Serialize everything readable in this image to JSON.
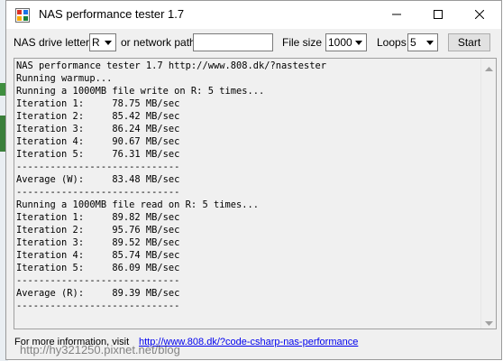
{
  "window": {
    "title": "NAS performance tester 1.7"
  },
  "toolbar": {
    "drive_label": "NAS drive letter",
    "drive_value": "R",
    "network_label": "or network path",
    "network_value": "",
    "filesize_label": "File size",
    "filesize_value": "1000",
    "loops_label": "Loops",
    "loops_value": "5",
    "start_label": "Start"
  },
  "output": {
    "text": "NAS performance tester 1.7 http://www.808.dk/?nastester\nRunning warmup...\nRunning a 1000MB file write on R: 5 times...\nIteration 1:     78.75 MB/sec\nIteration 2:     85.42 MB/sec\nIteration 3:     86.24 MB/sec\nIteration 4:     90.67 MB/sec\nIteration 5:     76.31 MB/sec\n-----------------------------\nAverage (W):     83.48 MB/sec\n-----------------------------\nRunning a 1000MB file read on R: 5 times...\nIteration 1:     89.82 MB/sec\nIteration 2:     95.76 MB/sec\nIteration 3:     89.52 MB/sec\nIteration 4:     85.74 MB/sec\nIteration 5:     86.09 MB/sec\n-----------------------------\nAverage (R):     89.39 MB/sec\n-----------------------------"
  },
  "footer": {
    "info_label": "For more information, visit",
    "link_text": "http://www.808.dk/?code-csharp-nas-performance"
  },
  "watermark": {
    "text": "http://hy321250.pixnet.net/blog"
  },
  "icons": {
    "app": "app-icon",
    "minimize": "minimize-icon",
    "maximize": "maximize-icon",
    "close": "close-icon",
    "dropdown": "chevron-down-icon"
  }
}
